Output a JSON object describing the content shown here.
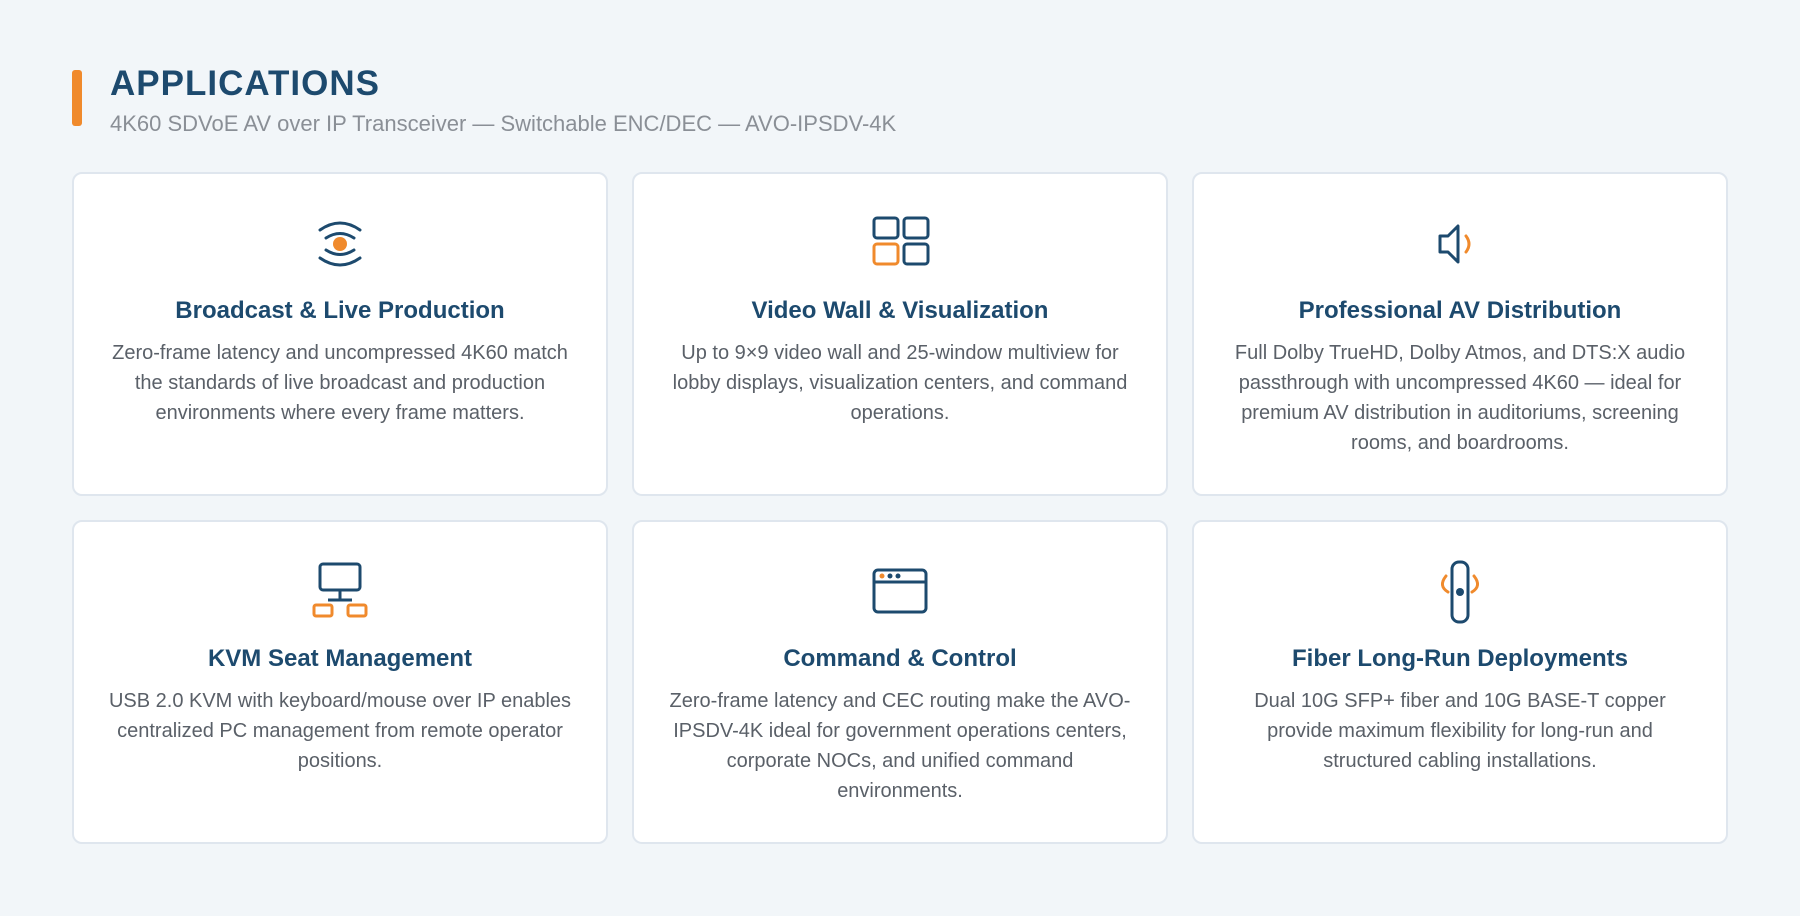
{
  "header": {
    "title": "APPLICATIONS",
    "subtitle": "4K60 SDVoE AV over IP Transceiver — Switchable ENC/DEC — AVO-IPSDV-4K"
  },
  "colors": {
    "accent": "#f08a2c",
    "primary": "#1d4a6e",
    "text": "#5a6068",
    "background": "#f2f6f9"
  },
  "cards": [
    {
      "icon": "broadcast-icon",
      "title": "Broadcast & Live Production",
      "description": "Zero-frame latency and uncompressed 4K60 match the standards of live broadcast and production environments where every frame matters."
    },
    {
      "icon": "video-wall-icon",
      "title": "Video Wall & Visualization",
      "description": "Up to 9×9 video wall and 25-window multiview for lobby displays, visualization centers, and command operations."
    },
    {
      "icon": "speaker-icon",
      "title": "Professional AV Distribution",
      "description": "Full Dolby TrueHD, Dolby Atmos, and DTS:X audio passthrough with uncompressed 4K60 — ideal for premium AV distribution in auditoriums, screening rooms, and boardrooms."
    },
    {
      "icon": "kvm-network-icon",
      "title": "KVM Seat Management",
      "description": "USB 2.0 KVM with keyboard/mouse over IP enables centralized PC management from remote operator positions."
    },
    {
      "icon": "browser-window-icon",
      "title": "Command & Control",
      "description": "Zero-frame latency and CEC routing make the AVO-IPSDV-4K ideal for government operations centers, corporate NOCs, and unified command environments."
    },
    {
      "icon": "fiber-cable-icon",
      "title": "Fiber Long-Run Deployments",
      "description": "Dual 10G SFP+ fiber and 10G BASE-T copper provide maximum flexibility for long-run and structured cabling installations."
    }
  ]
}
